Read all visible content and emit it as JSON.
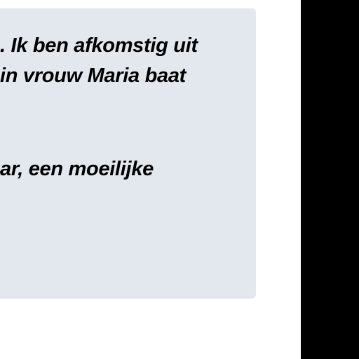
{
  "message": {
    "lines": [
      ". Ik ben afkomstig uit",
      "in vrouw Maria baat",
      "ar, een moeilijke"
    ]
  },
  "colors": {
    "card_background": "#e3e8ee",
    "page_background": "#ffffff",
    "right_strip": "#000000",
    "text": "#000000"
  }
}
